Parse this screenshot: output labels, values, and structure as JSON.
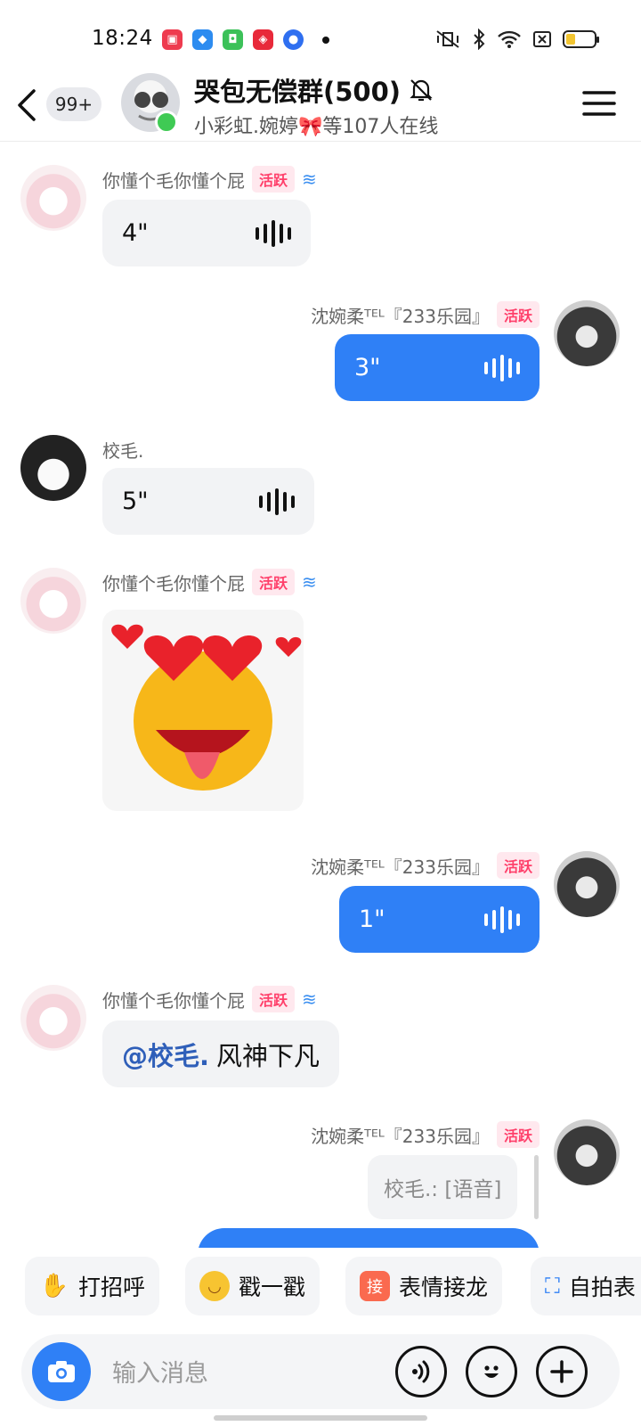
{
  "status_bar": {
    "time": "18:24"
  },
  "header": {
    "unread_badge": "99+",
    "group_title": "哭包无偿群(500)",
    "online_text": "小彩虹.婉婷🎀等107人在线"
  },
  "messages": [
    {
      "sender": "你懂个毛你懂个屁",
      "badge": "活跃",
      "voice": "4\""
    },
    {
      "sender": "沈婉柔ᵀᴱᴸ『233乐园』",
      "badge": "活跃",
      "voice": "3\""
    },
    {
      "sender": "校毛.",
      "voice": "5\""
    },
    {
      "sender": "你懂个毛你懂个屁",
      "badge": "活跃"
    },
    {
      "sender": "沈婉柔ᵀᴱᴸ『233乐园』",
      "badge": "活跃",
      "voice": "1\""
    },
    {
      "sender": "你懂个毛你懂个屁",
      "badge": "活跃",
      "mention": "@校毛.",
      "text": "风神下凡"
    },
    {
      "sender": "沈婉柔ᵀᴱᴸ『233乐园』",
      "badge": "活跃",
      "quote": "校毛.: [语音]"
    }
  ],
  "quick_actions": [
    "打招呼",
    "戳一戳",
    "表情接龙",
    "自拍表"
  ],
  "quick_action_icon_text": "接",
  "input": {
    "placeholder": "输入消息"
  },
  "colors": {
    "accent": "#2f80f6",
    "active_badge": "#ff3f6a",
    "online": "#3fca54"
  }
}
